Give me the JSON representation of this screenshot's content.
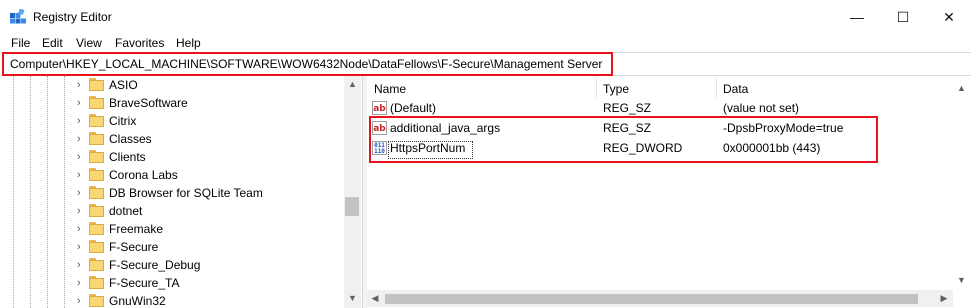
{
  "window": {
    "title": "Registry Editor",
    "buttons": {
      "minimize": "—",
      "maximize": "☐",
      "close": "✕"
    }
  },
  "menu": [
    "File",
    "Edit",
    "View",
    "Favorites",
    "Help"
  ],
  "address": {
    "path": "Computer\\HKEY_LOCAL_MACHINE\\SOFTWARE\\WOW6432Node\\DataFellows\\F-Secure\\Management Server"
  },
  "tree": {
    "items": [
      {
        "label": "ASIO"
      },
      {
        "label": "BraveSoftware"
      },
      {
        "label": "Citrix"
      },
      {
        "label": "Classes"
      },
      {
        "label": "Clients"
      },
      {
        "label": "Corona Labs"
      },
      {
        "label": "DB Browser for SQLite Team"
      },
      {
        "label": "dotnet"
      },
      {
        "label": "Freemake"
      },
      {
        "label": "F-Secure"
      },
      {
        "label": "F-Secure_Debug"
      },
      {
        "label": "F-Secure_TA"
      },
      {
        "label": "GnuWin32"
      }
    ]
  },
  "list": {
    "columns": {
      "name": "Name",
      "type": "Type",
      "data": "Data"
    },
    "rows": [
      {
        "name": "(Default)",
        "type": "REG_SZ",
        "data": "(value not set)",
        "icon": "string-value-icon"
      },
      {
        "name": "additional_java_args",
        "type": "REG_SZ",
        "data": "-DpsbProxyMode=true",
        "icon": "string-value-icon"
      },
      {
        "name": "HttpsPortNum",
        "type": "REG_DWORD",
        "data": "0x000001bb (443)",
        "icon": "binary-value-icon"
      }
    ]
  },
  "colors": {
    "highlight": "#e8121b",
    "folder": "#f8d774"
  }
}
